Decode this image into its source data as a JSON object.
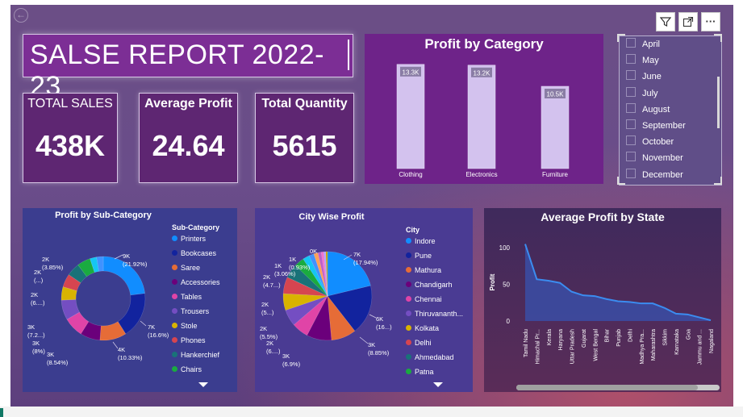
{
  "report": {
    "title": "SALSE REPORT 2022-23"
  },
  "kpis": [
    {
      "label": "TOTAL SALES",
      "value": "438K"
    },
    {
      "label": "Average Profit",
      "value": "24.64"
    },
    {
      "label": "Total Quantity",
      "value": "5615"
    }
  ],
  "visual_header": {
    "filter_icon": "filter-icon",
    "focus_icon": "focus-mode-icon",
    "more_icon": "more-options-icon",
    "more_label": "···",
    "back_icon": "back-arrow-icon"
  },
  "month_slicer": {
    "items": [
      "April",
      "May",
      "June",
      "July",
      "August",
      "September",
      "October",
      "November",
      "December"
    ]
  },
  "chart_data": [
    {
      "id": "profit_by_category",
      "type": "bar",
      "title": "Profit by Category",
      "categories": [
        "Clothing",
        "Electronics",
        "Furniture"
      ],
      "values": [
        13300,
        13200,
        10500
      ],
      "data_labels": [
        "13.3K",
        "13.2K",
        "10.5K"
      ],
      "bar_color": "#d3c2ee"
    },
    {
      "id": "profit_by_subcategory",
      "type": "pie",
      "variant": "donut",
      "title": "Profit by Sub-Category",
      "legend_title": "Sub-Category",
      "categories": [
        "Printers",
        "Bookcases",
        "Saree",
        "Accessories",
        "Tables",
        "Trousers",
        "Stole",
        "Phones",
        "Hankerchief",
        "Chairs"
      ],
      "colors": [
        "#118dff",
        "#12239e",
        "#e66c37",
        "#6b007b",
        "#e044a7",
        "#744ec2",
        "#d9b300",
        "#d64550",
        "#197278",
        "#1aab40"
      ],
      "slice_values": [
        9,
        7,
        4,
        3,
        3,
        3,
        2,
        2,
        2,
        2,
        1,
        1
      ],
      "slice_colors": [
        "#118dff",
        "#12239e",
        "#e66c37",
        "#6b007b",
        "#e044a7",
        "#744ec2",
        "#d9b300",
        "#d64550",
        "#197278",
        "#1aab40",
        "#15c6f4",
        "#4092ff"
      ],
      "data_labels": [
        "9K (21.92%)",
        "7K (16.6%)",
        "4K (10.33%)",
        "3K (8.54%)",
        "3K (8%)",
        "3K (7.2...)",
        "2K (6....)",
        "2K (...)",
        "2K (3.85%)"
      ]
    },
    {
      "id": "city_wise_profit",
      "type": "pie",
      "title": "City Wise Profit",
      "legend_title": "City",
      "categories": [
        "Indore",
        "Pune",
        "Mathura",
        "Chandigarh",
        "Chennai",
        "Thiruvananth...",
        "Kolkata",
        "Delhi",
        "Ahmedabad",
        "Patna"
      ],
      "colors": [
        "#118dff",
        "#12239e",
        "#e66c37",
        "#6b007b",
        "#e044a7",
        "#744ec2",
        "#d9b300",
        "#d64550",
        "#197278",
        "#1aab40"
      ],
      "slice_values": [
        7,
        6,
        3,
        3,
        2,
        2,
        2,
        2,
        1.7,
        1.2,
        0.8,
        0.6,
        0.5,
        0.4,
        0.3,
        0.25,
        0.2
      ],
      "slice_colors": [
        "#118dff",
        "#12239e",
        "#e66c37",
        "#6b007b",
        "#e044a7",
        "#744ec2",
        "#d9b300",
        "#d64550",
        "#197278",
        "#1aab40",
        "#15c6f4",
        "#4092ff",
        "#ffa058",
        "#be5dc9",
        "#f472d0",
        "#b5a1ff",
        "#c4a200"
      ],
      "data_labels": [
        "7K (17.94%)",
        "6K (16...)",
        "3K (8.85%)",
        "3K (6.9%)",
        "2K (6....)",
        "2K (5.5%)",
        "2K (5...)",
        "2K (4.7...)",
        "1K (3.06%)",
        "1K (0.93%)",
        "0K"
      ]
    },
    {
      "id": "avg_profit_by_state",
      "type": "area",
      "title": "Average Profit by State",
      "ylabel": "Profit",
      "yticks": [
        "0",
        "50",
        "100"
      ],
      "ylim": [
        0,
        110
      ],
      "categories": [
        "Tamil Nadu",
        "Himachal Pr...",
        "Kerala",
        "Haryana",
        "Uttar Pradesh",
        "Gujarat",
        "West Bengal",
        "Bihar",
        "Punjab",
        "Delhi",
        "Madhya Pra...",
        "Maharashtra",
        "Sikkim",
        "Karnataka",
        "Goa",
        "Jammu and ...",
        "Nagaland"
      ],
      "values": [
        105,
        57,
        55,
        52,
        40,
        35,
        34,
        30,
        27,
        26,
        24,
        24,
        18,
        10,
        9,
        5,
        1
      ],
      "line_color": "#3b8cf0",
      "fill_color": "#3a4ea6"
    }
  ]
}
